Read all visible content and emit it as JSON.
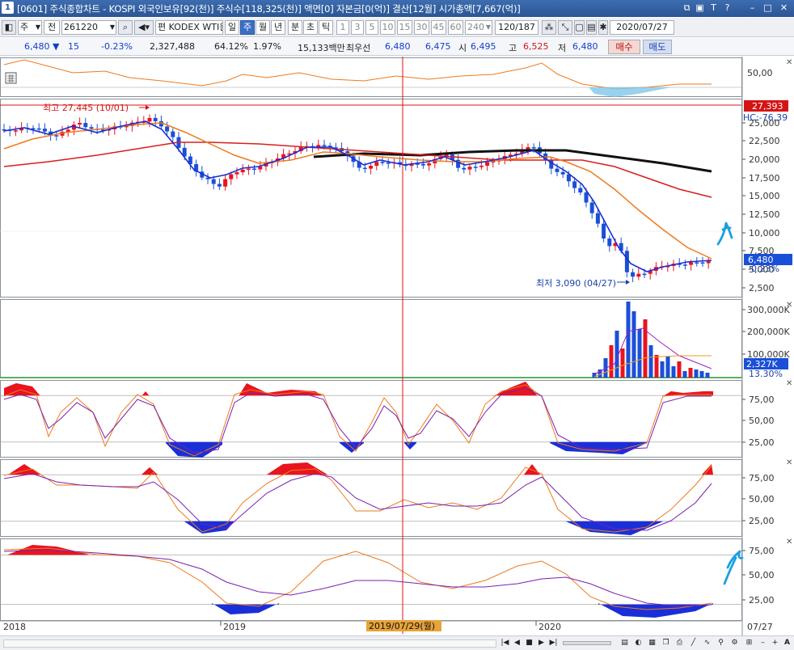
{
  "window": {
    "title": "[0601] 주식종합차트 - KOSPI 외국인보유[92(천)] 주식수[118,325(천)] 액면[0] 자본금[0(억)] 결산[12월] 시가총액[7,667(억)]",
    "icon_label": "1",
    "buttons": [
      "⧉",
      "▣",
      "T",
      "?",
      "–",
      "□",
      "✕"
    ]
  },
  "toolbar": {
    "period_select": "주",
    "ticker_type": "전",
    "code": "261220",
    "name": "KODEX WTI원",
    "edit_label": "편",
    "timeframes": [
      "일",
      "주",
      "월",
      "년",
      "분",
      "초",
      "틱"
    ],
    "active_timeframe": "주",
    "intervals": [
      "1",
      "3",
      "5",
      "10",
      "15",
      "30",
      "45",
      "60",
      "240"
    ],
    "count": "120",
    "count_total": "/187",
    "date": "2020/07/27"
  },
  "quote": {
    "price": "6,480",
    "change_arrow": "▼",
    "change": "15",
    "change_pct": "-0.23%",
    "volume": "2,327,488",
    "ratio1": "64.12%",
    "ratio2": "1.97%",
    "amount": "15,133백만",
    "priority_label": "최우선",
    "ask": "6,480",
    "bid": "6,475",
    "open_label": "시",
    "open": "6,495",
    "high_label": "고",
    "high": "6,525",
    "low_label": "저",
    "low": "6,480",
    "buy_label": "매수",
    "sell_label": "매도"
  },
  "chart": {
    "top_axis": [
      "50,00"
    ],
    "price_axis": [
      "25,000",
      "22,500",
      "20,000",
      "17,500",
      "15,000",
      "12,500",
      "10,000",
      "7,500",
      "5,000",
      "2,500"
    ],
    "price_hline_label": "27,393",
    "hc_label": "HC:-76,39",
    "current_price_label": "6,480",
    "current_change_label": "-0.23%",
    "high_annotation": "최고 27,445 (10/01)",
    "low_annotation": "최저 3,090 (04/27)",
    "volume_axis": [
      "300,000K",
      "200,000K",
      "100,000K"
    ],
    "volume_current": "2,327K",
    "volume_pct": "13.30%",
    "osc1_axis": [
      "75,00",
      "50,00",
      "25,00"
    ],
    "osc2_axis": [
      "75,00",
      "50,00",
      "25,00"
    ],
    "osc3_axis": [
      "75,00",
      "50,00",
      "25,00"
    ],
    "x_labels": [
      "2018",
      "2019",
      "2020"
    ],
    "x_cursor_label": "2019/07/29(월)",
    "x_end_label": "07/27"
  },
  "colors": {
    "up": "#e8141e",
    "down": "#1a4fd8",
    "ma_short": "#1a2fd0",
    "ma_mid": "#ee7a1e",
    "ma_long": "#d81e1e",
    "ma_200": "#111111",
    "annotation_pen": "#1aa0e0"
  },
  "icons": {
    "period_dropdown": "chevron-down-icon",
    "search": "search-icon",
    "speaker": "speaker-icon",
    "settings": "gear-icon",
    "save": "save-icon",
    "nav": [
      "first-icon",
      "prev-icon",
      "stop-icon",
      "next-icon",
      "last-icon"
    ],
    "zoom": [
      "zoom-out-icon",
      "zoom-in-icon"
    ]
  }
}
